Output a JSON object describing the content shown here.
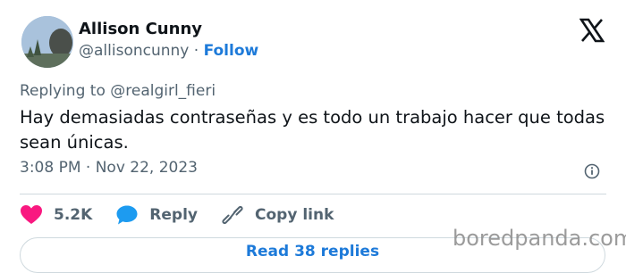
{
  "author": {
    "display_name": "Allison Cunny",
    "handle": "@allisoncunny",
    "separator": "·",
    "follow_label": "Follow"
  },
  "reply_context": "Replying to @realgirl_fieri",
  "tweet_text": "Hay demasiadas contraseñas y es todo un trabajo hacer que todas sean únicas.",
  "timestamp": "3:08 PM · Nov 22, 2023",
  "actions": {
    "likes": "5.2K",
    "reply_label": "Reply",
    "copy_link_label": "Copy link"
  },
  "read_replies_label": "Read 38 replies",
  "watermark": "boredpanda.com",
  "icons": {
    "logo": "x-logo-icon",
    "info": "info-icon",
    "like": "heart-icon",
    "reply": "speech-bubble-icon",
    "copy": "link-icon"
  },
  "colors": {
    "text": "#0f1419",
    "secondary": "#536471",
    "accent": "#1d7ad9",
    "like": "#f91880",
    "reply": "#1d9bf0",
    "divider": "#cfd9de"
  }
}
